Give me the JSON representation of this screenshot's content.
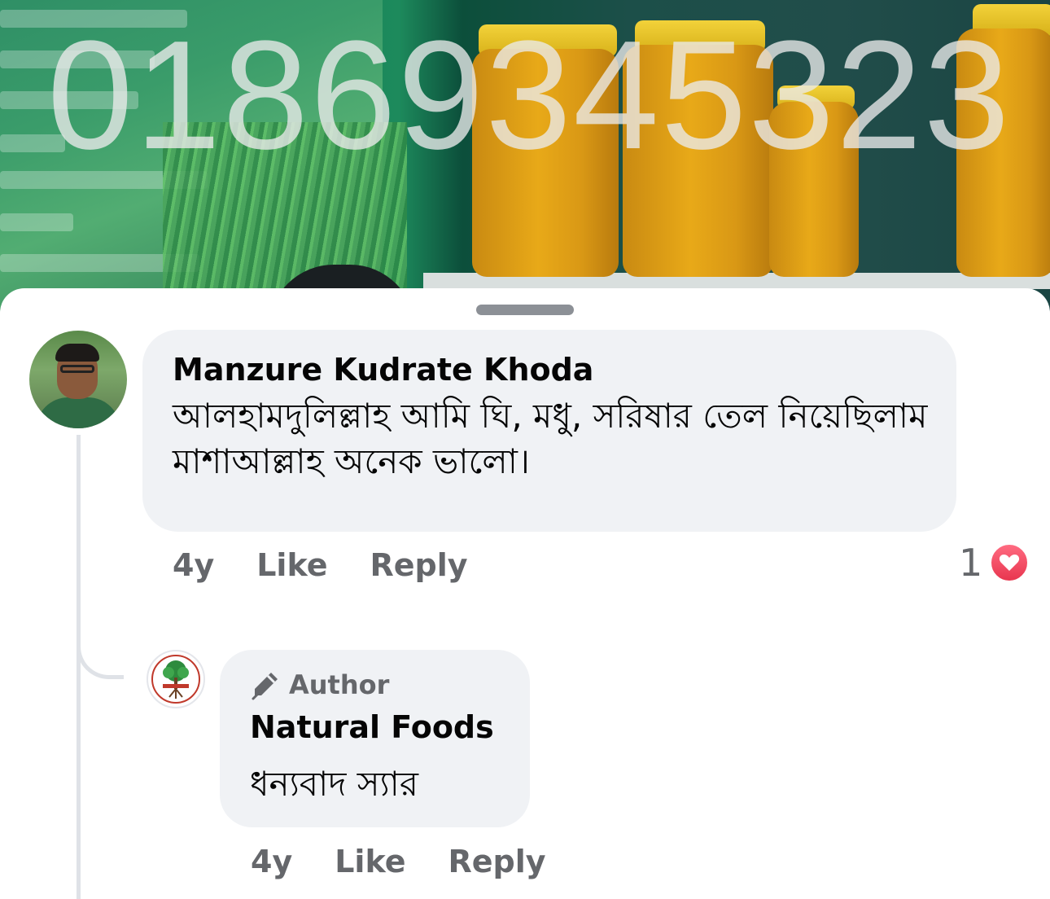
{
  "background": {
    "overlay_number": "01869345323"
  },
  "comments": [
    {
      "author": "Manzure Kudrate Khoda",
      "text": "আলহামদুলিল্লাহ আমি ঘি, মধু, সরিষার তেল নিয়েছিলাম মাশাআল্লাহ অনেক ভালো।",
      "time": "4y",
      "like_label": "Like",
      "reply_label": "Reply",
      "reaction_count": "1",
      "reaction_icon": "heart-icon"
    }
  ],
  "reply": {
    "badge_icon": "pen-icon",
    "badge_label": "Author",
    "author": "Natural Foods",
    "text": "ধন্যবাদ স্যার",
    "time": "4y",
    "like_label": "Like",
    "reply_label": "Reply"
  },
  "colors": {
    "bubble": "#f0f2f5",
    "secondary_text": "#65676b",
    "heart": "#e8364f"
  }
}
